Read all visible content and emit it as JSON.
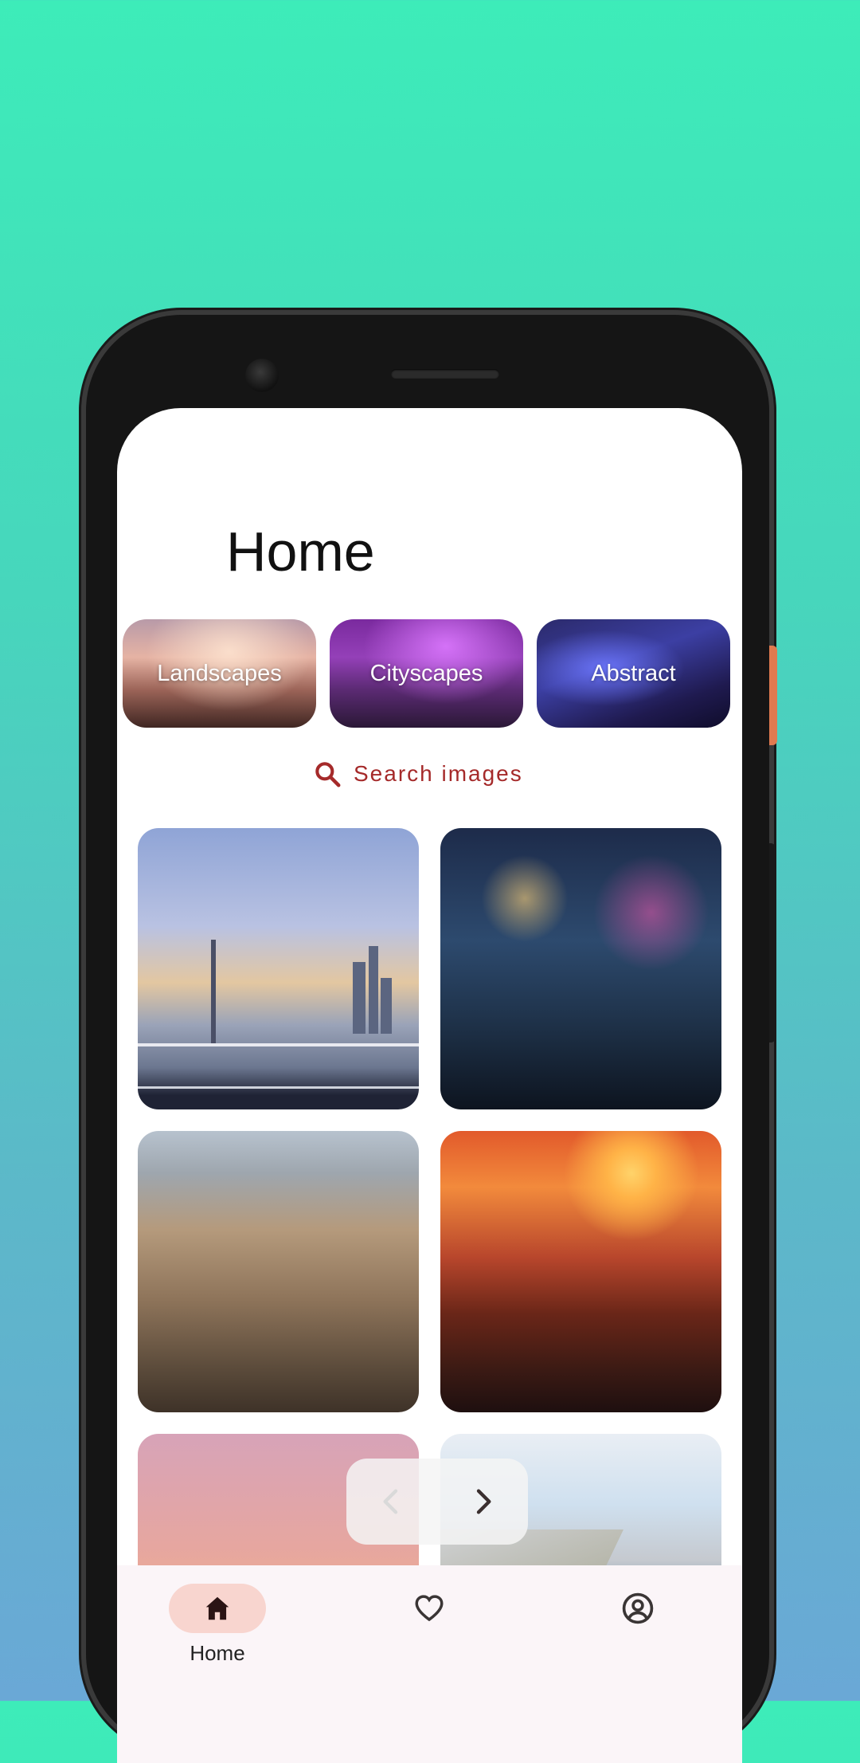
{
  "page": {
    "title": "Home"
  },
  "categories": [
    {
      "label": "Landscapes"
    },
    {
      "label": "Cityscapes"
    },
    {
      "label": "Abstract"
    }
  ],
  "search": {
    "label": "Search images",
    "icon": "search-icon",
    "color": "#A52A2A"
  },
  "gallery": {
    "images": [
      {
        "name": "city-river-tower"
      },
      {
        "name": "neon-anime-city"
      },
      {
        "name": "aerial-old-town"
      },
      {
        "name": "sunset-red-city"
      },
      {
        "name": "pink-sunset-street"
      },
      {
        "name": "coastal-city"
      }
    ]
  },
  "carousel_controls": {
    "prev_icon": "chevron-left-icon",
    "next_icon": "chevron-right-icon"
  },
  "bottom_nav": {
    "items": [
      {
        "label": "Home",
        "icon": "home-icon",
        "selected": true
      },
      {
        "label": "",
        "icon": "heart-icon",
        "selected": false
      },
      {
        "label": "",
        "icon": "account-icon",
        "selected": false
      }
    ],
    "accent": "#F8D5CF"
  }
}
